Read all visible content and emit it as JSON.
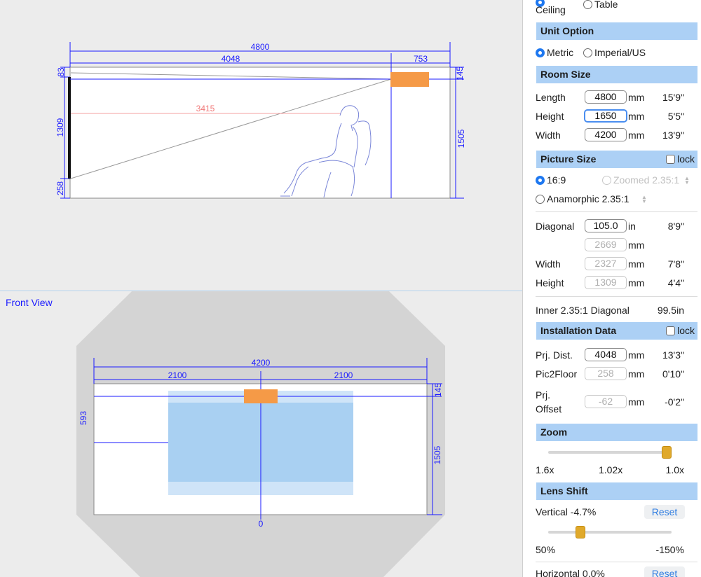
{
  "side_view": {
    "dims": {
      "room_length": "4800",
      "throw": "4048",
      "offset_front": "753",
      "top_gap": "83",
      "right_top": "145",
      "screen_h": "1309",
      "bottom_gap": "258",
      "room_h": "1505",
      "seat_dist": "3415"
    }
  },
  "front_view": {
    "title": "Front View",
    "dims": {
      "room_width": "4200",
      "left_half": "2100",
      "right_half": "2100",
      "top_right": "145",
      "left_h": "593",
      "right_h": "1505",
      "center": "0"
    }
  },
  "panel": {
    "mount": {
      "ceiling": "Ceiling",
      "table": "Table"
    },
    "unit_option": {
      "title": "Unit Option",
      "metric": "Metric",
      "imperial": "Imperial/US"
    },
    "room_size": {
      "title": "Room Size",
      "length": {
        "label": "Length",
        "value": "4800",
        "unit": "mm",
        "imperial": "15'9\""
      },
      "height": {
        "label": "Height",
        "value": "1650",
        "unit": "mm",
        "imperial": "5'5\""
      },
      "width": {
        "label": "Width",
        "value": "4200",
        "unit": "mm",
        "imperial": "13'9\""
      }
    },
    "picture_size": {
      "title": "Picture Size",
      "lock": "lock",
      "ratio_169": "16:9",
      "zoomed": "Zoomed 2.35:1",
      "anamorphic": "Anamorphic 2.35:1",
      "diagonal": {
        "label": "Diagonal",
        "value": "105.0",
        "unit": "in",
        "imperial": "8'9\""
      },
      "diagonal_mm": {
        "value": "2669",
        "unit": "mm"
      },
      "width": {
        "label": "Width",
        "value": "2327",
        "unit": "mm",
        "imperial": "7'8\""
      },
      "height": {
        "label": "Height",
        "value": "1309",
        "unit": "mm",
        "imperial": "4'4\""
      },
      "inner_label": "Inner 2.35:1 Diagonal",
      "inner_value": "99.5in"
    },
    "installation": {
      "title": "Installation Data",
      "lock": "lock",
      "prj_dist": {
        "label": "Prj. Dist.",
        "value": "4048",
        "unit": "mm",
        "imperial": "13'3\""
      },
      "pic2floor": {
        "label": "Pic2Floor",
        "value": "258",
        "unit": "mm",
        "imperial": "0'10\""
      },
      "prj_offset": {
        "label": "Prj. Offset",
        "value": "-62",
        "unit": "mm",
        "imperial": "-0'2\""
      }
    },
    "zoom": {
      "title": "Zoom",
      "min": "1.6x",
      "current": "1.02x",
      "max": "1.0x",
      "level": 0.96
    },
    "lens_shift": {
      "title": "Lens Shift",
      "vertical": "Vertical -4.7%",
      "reset": "Reset",
      "min": "50%",
      "max": "-150%",
      "level": 0.26,
      "horizontal": "Horizontal 0.0%",
      "reset2": "Reset"
    }
  },
  "colors": {
    "accent": "#1e78f0",
    "section": "#acd0f5",
    "projector": "#f59a47",
    "dimension": "#1a1aff",
    "knob": "#e0a92b"
  }
}
